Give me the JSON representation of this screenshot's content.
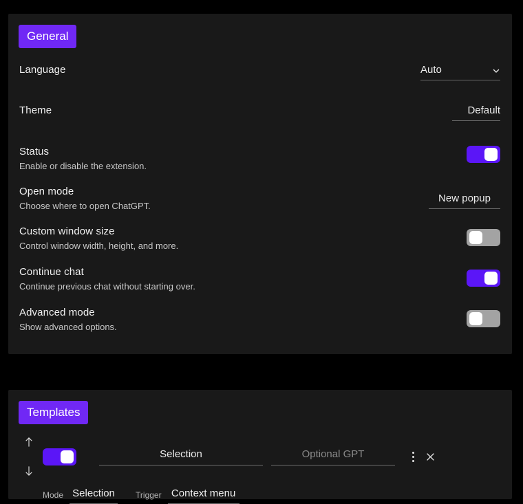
{
  "theme_colors": {
    "page_background": "#000000",
    "card_background": "#191919",
    "accent": "#7028f5",
    "toggle_on": "#5b16f7",
    "toggle_off": "#a3a3a3",
    "underline": "#6a6a6a",
    "text_primary": "#f0f0f0",
    "text_secondary": "#c8c8c8",
    "placeholder": "#8a8a8a"
  },
  "general": {
    "badge": "General",
    "rows": [
      {
        "title": "Language",
        "desc": "",
        "control": "select",
        "value": "Auto",
        "icon": "chevron-down-icon",
        "name": "language"
      },
      {
        "title": "Theme",
        "desc": "",
        "control": "value",
        "value": "Default",
        "name": "theme"
      },
      {
        "title": "Status",
        "desc": "Enable or disable the extension.",
        "control": "toggle",
        "value": "on",
        "name": "status"
      },
      {
        "title": "Open mode",
        "desc": "Choose where to open ChatGPT.",
        "control": "value",
        "value": "New popup",
        "name": "open-mode"
      },
      {
        "title": "Custom window size",
        "desc": "Control window width, height, and more.",
        "control": "toggle",
        "value": "off",
        "name": "custom-window-size"
      },
      {
        "title": "Continue chat",
        "desc": "Continue previous chat without starting over.",
        "control": "toggle",
        "value": "on",
        "name": "continue-chat"
      },
      {
        "title": "Advanced mode",
        "desc": "Show advanced options.",
        "control": "toggle",
        "value": "off",
        "name": "advanced-mode"
      }
    ]
  },
  "templates": {
    "badge": "Templates",
    "items": [
      {
        "enabled": "on",
        "name_value": "Selection",
        "gpt_placeholder": "Optional GPT",
        "gpt_value": "",
        "mode_label": "Mode",
        "mode_value": "Selection",
        "trigger_label": "Trigger",
        "trigger_value": "Context menu",
        "move_up_icon": "arrow-up-icon",
        "move_down_icon": "arrow-down-icon",
        "menu_icon": "kebab-menu-icon",
        "close_icon": "close-icon"
      }
    ]
  }
}
